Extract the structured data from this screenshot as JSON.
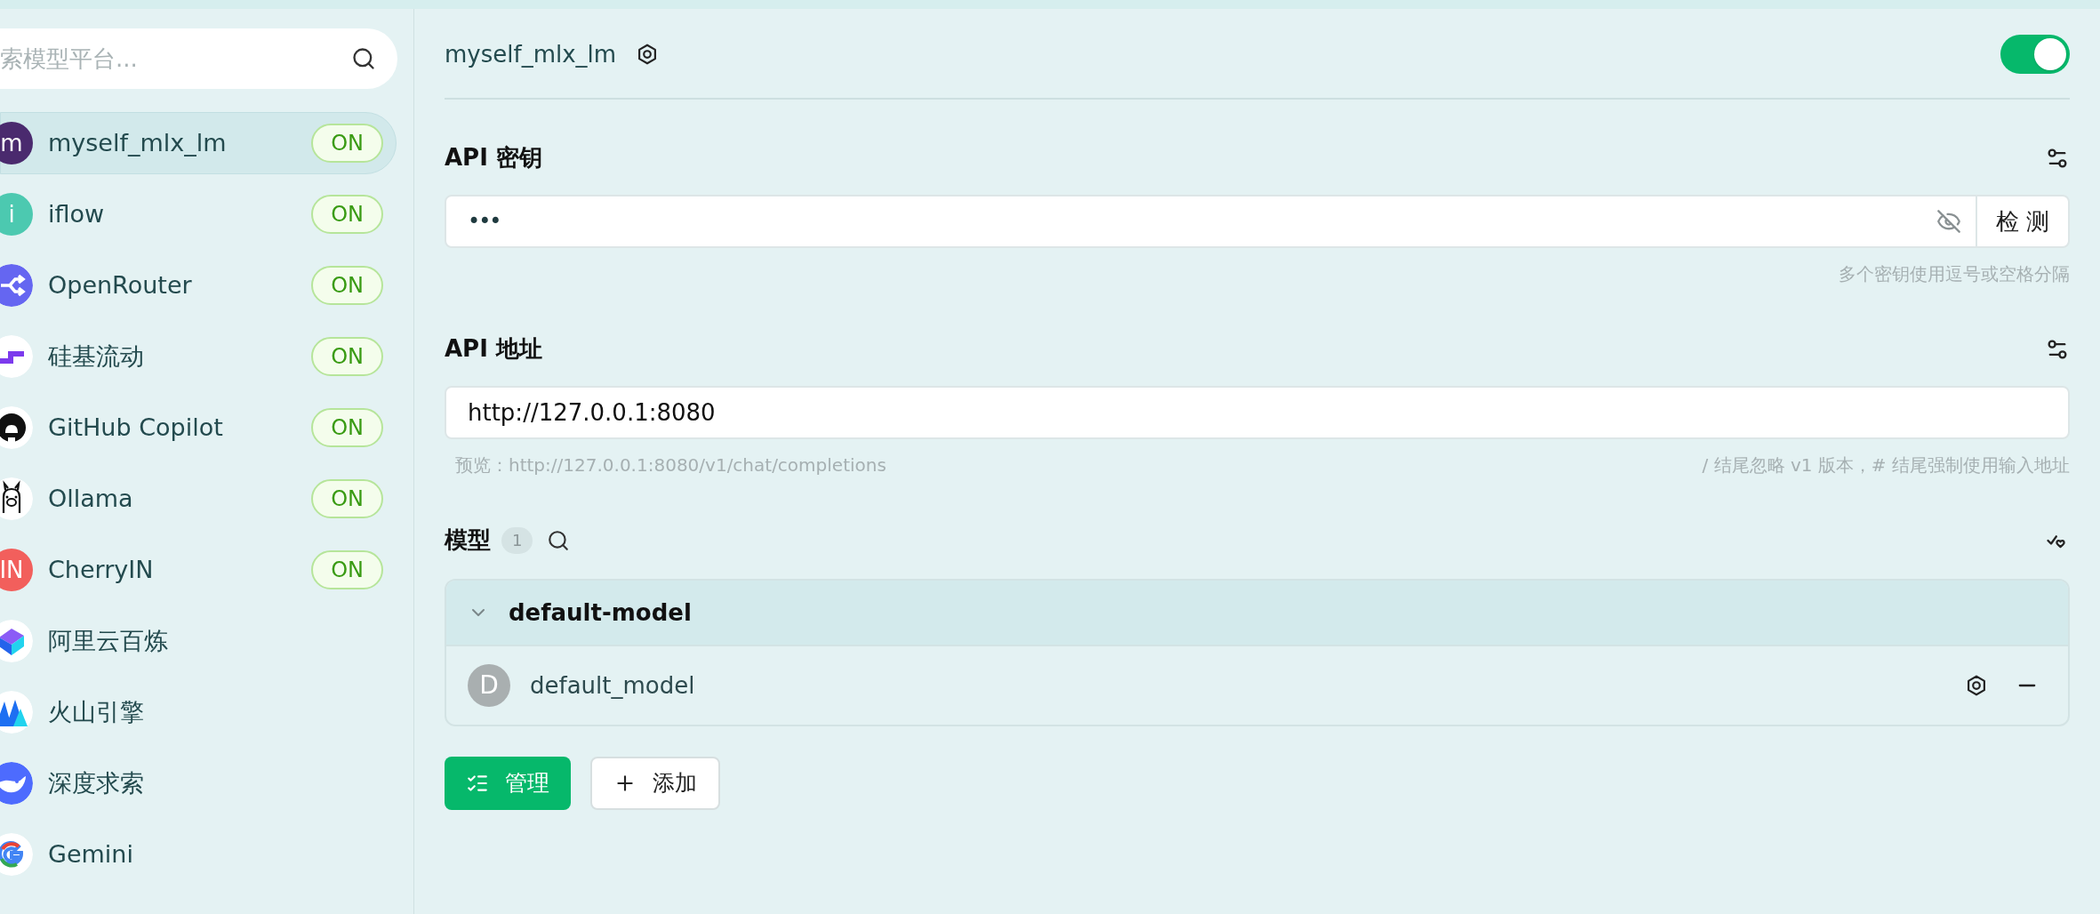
{
  "sidebar": {
    "search": {
      "placeholder": "索模型平台..."
    },
    "providers": [
      {
        "name": "myself_mlx_lm",
        "selected": true,
        "badge": "ON",
        "kind": "letter",
        "letter": "m",
        "color": "#4a2a6e"
      },
      {
        "name": "iflow",
        "selected": false,
        "badge": "ON",
        "kind": "letter",
        "letter": "i",
        "color": "#4cc9b0"
      },
      {
        "name": "OpenRouter",
        "selected": false,
        "badge": "ON",
        "kind": "openrouter"
      },
      {
        "name": "硅基流动",
        "selected": false,
        "badge": "ON",
        "kind": "siliconflow"
      },
      {
        "name": "GitHub Copilot",
        "selected": false,
        "badge": "ON",
        "kind": "github"
      },
      {
        "name": "Ollama",
        "selected": false,
        "badge": "ON",
        "kind": "ollama"
      },
      {
        "name": "CherryIN",
        "selected": false,
        "badge": "ON",
        "kind": "letter",
        "letter": "IN",
        "color": "#f25f5c"
      },
      {
        "name": "阿里云百炼",
        "selected": false,
        "kind": "bailian"
      },
      {
        "name": "火山引擎",
        "selected": false,
        "kind": "volcano"
      },
      {
        "name": "深度求索",
        "selected": false,
        "kind": "deepseek"
      },
      {
        "name": "Gemini",
        "selected": false,
        "kind": "gemini"
      }
    ]
  },
  "header": {
    "title": "myself_mlx_lm",
    "enabled": true
  },
  "api_key": {
    "label": "API 密钥",
    "value": "•••",
    "check_button": "检 测",
    "hint": "多个密钥使用逗号或空格分隔"
  },
  "api_url": {
    "label": "API 地址",
    "value": "http://127.0.0.1:8080",
    "preview": "预览：http://127.0.0.1:8080/v1/chat/completions",
    "hint": "/ 结尾忽略 v1 版本，# 结尾强制使用输入地址"
  },
  "models": {
    "label": "模型",
    "count": "1",
    "groups": [
      {
        "name": "default-model",
        "expanded": true,
        "models": [
          {
            "avatar": "D",
            "name": "default_model"
          }
        ]
      }
    ],
    "buttons": [
      {
        "kind": "manage",
        "label": "管理"
      },
      {
        "kind": "add",
        "label": "添加"
      }
    ]
  }
}
